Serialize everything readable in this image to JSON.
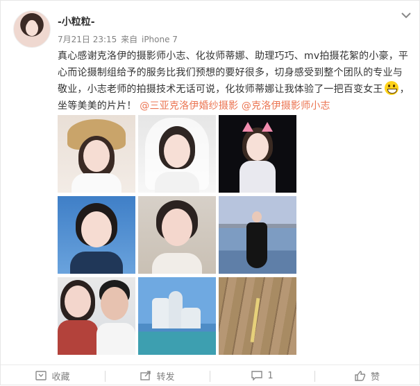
{
  "user": {
    "nickname": "-小粒粒-"
  },
  "meta": {
    "time": "7月21日 23:15",
    "source_prefix": "来自",
    "source": "iPhone 7"
  },
  "post": {
    "line1": "真心感谢克洛伊的摄影师小志、化妆师蒂娜、助理巧巧、mv拍摄花絮的小豪，平",
    "line2": "心而论摄制组给予的服务比我们预想的要好很多，切身感受到整个团队的专业与",
    "line3": "敬业，小志老师的拍摄技术无话可说，化妆师蒂娜让我体验了一把百变女王",
    "line3_end": "，",
    "line4_text": "坐等美美的片片！",
    "mention1": "@三亚克洛伊婚纱摄影",
    "mention2": "@克洛伊摄影师小志"
  },
  "actions": {
    "favorite": "收藏",
    "repost": "转发",
    "comment_count": "1",
    "like": "赞"
  },
  "colors": {
    "mention": "#eb7350",
    "meta": "#808080"
  }
}
